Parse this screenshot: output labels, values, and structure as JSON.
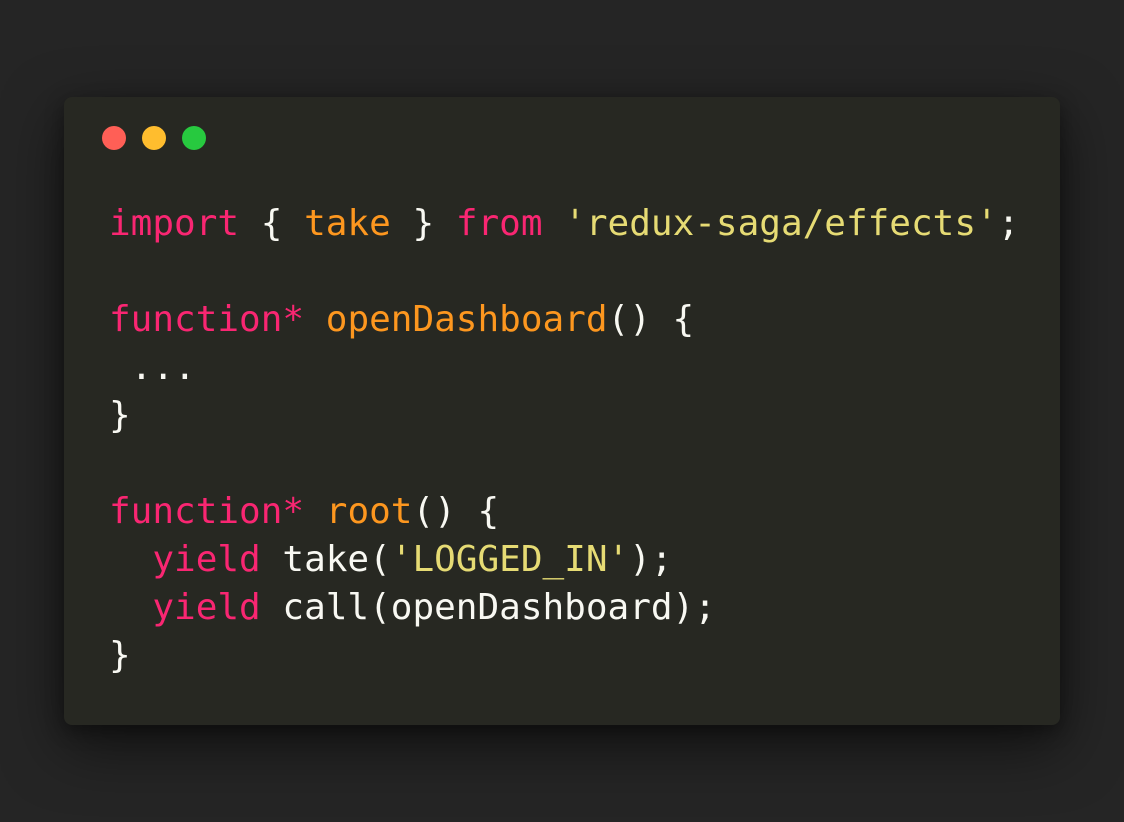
{
  "window": {
    "controls": [
      {
        "name": "close",
        "color": "#ff5f56"
      },
      {
        "name": "minimize",
        "color": "#ffbd2e"
      },
      {
        "name": "maximize",
        "color": "#27c93f"
      }
    ]
  },
  "code": {
    "lines": [
      {
        "tokens": [
          {
            "text": "import",
            "type": "keyword"
          },
          {
            "text": " { ",
            "type": "plain"
          },
          {
            "text": "take",
            "type": "func"
          },
          {
            "text": " } ",
            "type": "plain"
          },
          {
            "text": "from",
            "type": "keyword"
          },
          {
            "text": " ",
            "type": "plain"
          },
          {
            "text": "'redux-saga/effects'",
            "type": "string"
          },
          {
            "text": ";",
            "type": "plain"
          }
        ]
      },
      {
        "tokens": []
      },
      {
        "tokens": [
          {
            "text": "function*",
            "type": "keyword"
          },
          {
            "text": " ",
            "type": "plain"
          },
          {
            "text": "openDashboard",
            "type": "func"
          },
          {
            "text": "() {",
            "type": "plain"
          }
        ]
      },
      {
        "tokens": [
          {
            "text": " ...",
            "type": "plain"
          }
        ]
      },
      {
        "tokens": [
          {
            "text": "}",
            "type": "plain"
          }
        ]
      },
      {
        "tokens": []
      },
      {
        "tokens": [
          {
            "text": "function*",
            "type": "keyword"
          },
          {
            "text": " ",
            "type": "plain"
          },
          {
            "text": "root",
            "type": "func"
          },
          {
            "text": "() {",
            "type": "plain"
          }
        ]
      },
      {
        "tokens": [
          {
            "text": "  ",
            "type": "plain"
          },
          {
            "text": "yield",
            "type": "keyword"
          },
          {
            "text": " take(",
            "type": "plain"
          },
          {
            "text": "'LOGGED_IN'",
            "type": "string"
          },
          {
            "text": ");",
            "type": "plain"
          }
        ]
      },
      {
        "tokens": [
          {
            "text": "  ",
            "type": "plain"
          },
          {
            "text": "yield",
            "type": "keyword"
          },
          {
            "text": " call(openDashboard);",
            "type": "plain"
          }
        ]
      },
      {
        "tokens": [
          {
            "text": "}",
            "type": "plain"
          }
        ]
      }
    ]
  }
}
